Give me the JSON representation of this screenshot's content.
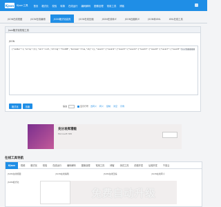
{
  "nav": {
    "logo": "Kjson",
    "logo_sub": "Kjson工具",
    "items": [
      "首页",
      "格式化",
      "校验",
      "转换",
      "在线运行",
      "编码解码",
      "图像处理",
      "常用工具",
      "博客"
    ]
  },
  "tool_tabs": [
    "JSON在线视图",
    "JSON在线编辑",
    "JSON格式化高亮",
    "JSON在线压缩",
    "JSON在线转义",
    "JSON压缩转义",
    "JSON转XML",
    "XML在线工具"
  ],
  "panel": {
    "heading": "Json格式化校验工具",
    "json_label": "JSON",
    "json_text": "{\"number\":1,\"array\":[1],\"null\":null,\"string\":\"foo108\",\"boolean\":true,\"obj\":{},\"level1\":{\"level2\":{\"level3\":{\"level4\":{\"level5\":{\"level6\":{\"level7\":{\"level8\":",
    "json_text_tail": "\"...\"}}}}}}}}"
  },
  "actions": {
    "format_button": "格式化",
    "compress_button": "压缩",
    "indent_label": "缩进",
    "checkbox_label": "显示行号",
    "links": [
      "去转义",
      "转义",
      "复制",
      "清空",
      "示例"
    ]
  },
  "ad": {
    "title": "充分发挥潜能",
    "subtitle": "Microsoft 365"
  },
  "lower": {
    "section_title": "在线工具导航",
    "tabs": [
      "Kjson",
      "视频",
      "格式化",
      "校验",
      "在线运行",
      "编码解码",
      "图像处理",
      "常用工具",
      "博客",
      "测试工具",
      "前端开发",
      "后端开发",
      "千易云"
    ],
    "links": [
      "JSON在线视图",
      "JSON在线编辑",
      "JSON在线压缩",
      "JSON在线转义",
      "JSON格式化",
      "JSON转XML",
      "XML在线工具",
      "JSON在线对比"
    ]
  },
  "bottom_ad": {
    "text": "免费自动升级"
  }
}
